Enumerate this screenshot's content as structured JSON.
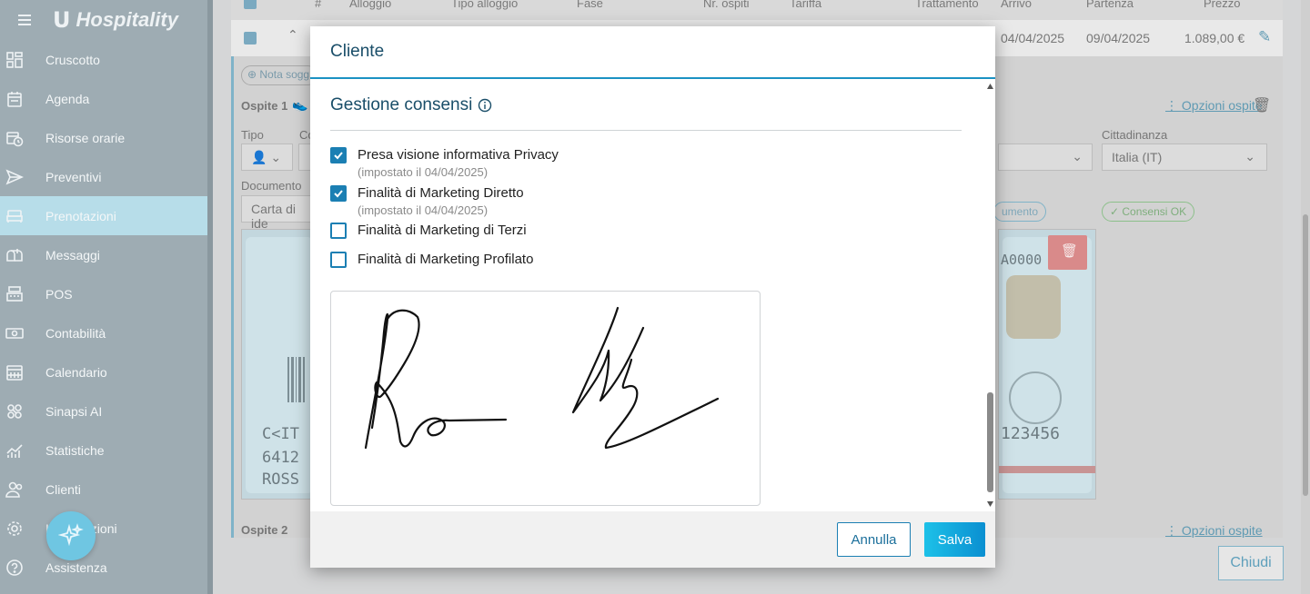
{
  "app": {
    "brand_mark": "U",
    "brand_name": "Hospitality"
  },
  "sidebar": {
    "items": [
      {
        "label": "Cruscotto",
        "icon": "dashboard-icon"
      },
      {
        "label": "Agenda",
        "icon": "agenda-icon"
      },
      {
        "label": "Risorse orarie",
        "icon": "calendar-clock-icon"
      },
      {
        "label": "Preventivi",
        "icon": "send-icon"
      },
      {
        "label": "Prenotazioni",
        "icon": "bed-icon",
        "active": true
      },
      {
        "label": "Messaggi",
        "icon": "mailbox-icon"
      },
      {
        "label": "POS",
        "icon": "cash-register-icon"
      },
      {
        "label": "Contabilità",
        "icon": "money-icon"
      },
      {
        "label": "Calendario",
        "icon": "calendar-icon"
      },
      {
        "label": "Sinapsi AI",
        "icon": "ai-icon"
      },
      {
        "label": "Statistiche",
        "icon": "chart-icon"
      },
      {
        "label": "Clienti",
        "icon": "users-icon"
      },
      {
        "label": "Impostazioni",
        "icon": "gear-icon"
      },
      {
        "label": "Assistenza",
        "icon": "help-icon"
      }
    ]
  },
  "table": {
    "headers": {
      "num": "#",
      "alloggio": "Alloggio",
      "tipo": "Tipo alloggio",
      "fase": "Fase",
      "ospiti": "Nr. ospiti",
      "tariffa": "Tariffa",
      "trattamento": "Trattamento",
      "arrivo": "Arrivo",
      "partenza": "Partenza",
      "prezzo": "Prezzo"
    },
    "row": {
      "arrivo": "04/04/2025",
      "partenza": "09/04/2025",
      "prezzo": "1.089,00 €"
    }
  },
  "booking": {
    "nota": "Nota sogg",
    "ospite1": "Ospite 1",
    "ospite2": "Ospite 2",
    "tipo_label": "Tipo",
    "co_label": "Co",
    "cittadinanza_label": "Cittadinanza",
    "cittadinanza_value": "Italia (IT)",
    "documento_label": "Documento",
    "documento_value": "Carta di ide",
    "chip_documento": "umento",
    "chip_consensi": "Consensi OK",
    "opzioni_ospite": "Opzioni ospite",
    "opzioni_ospite_2": "Opzioni ospite",
    "chiudi": "Chiudi"
  },
  "modal": {
    "title": "Cliente",
    "section_title": "Gestione consensi",
    "consents": [
      {
        "label": "Presa visione informativa Privacy",
        "checked": true,
        "sub": "(impostato il 04/04/2025)"
      },
      {
        "label": "Finalità di Marketing Diretto",
        "checked": true,
        "sub": "(impostato il 04/04/2025)"
      },
      {
        "label": "Finalità di Marketing di Terzi",
        "checked": false
      },
      {
        "label": "Finalità di Marketing Profilato",
        "checked": false
      }
    ],
    "buttons": {
      "cancel": "Annulla",
      "save": "Salva"
    }
  },
  "colors": {
    "accent": "#1b7fb3",
    "title": "#1a4e69",
    "sidebar": "#9eacb3",
    "sidebar_active": "#b7dde9"
  }
}
